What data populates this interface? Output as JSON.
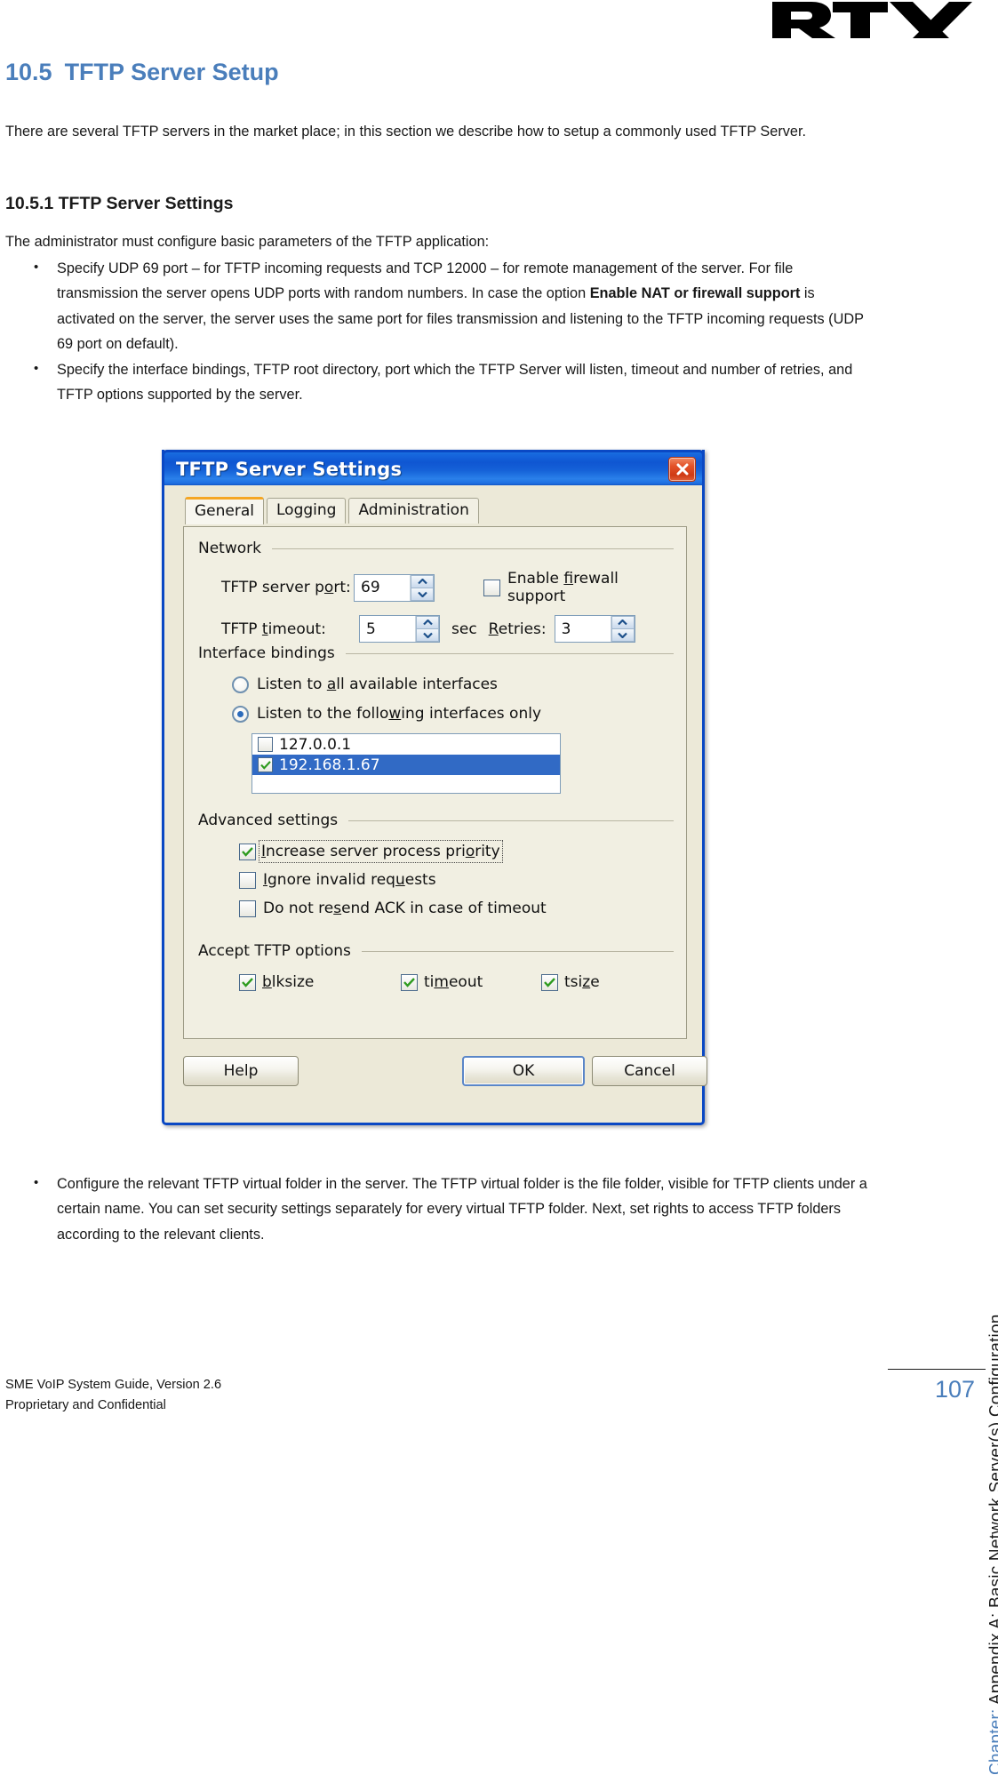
{
  "document": {
    "logo_alt": "RTX",
    "heading_number": "10.5",
    "heading_title": "TFTP Server Setup",
    "intro_paragraph": "There are several TFTP servers in the market place; in this section we describe how to setup a commonly used TFTP Server.",
    "subheading": "10.5.1 TFTP Server Settings",
    "admin_paragraph": "The administrator must configure basic parameters of the TFTP application:",
    "bullets_top": [
      {
        "pre": "Specify UDP 69 port – for TFTP incoming requests and TCP 12000 – for remote management of the server. For file transmission the server opens UDP ports with random numbers. In case the option ",
        "bold": "Enable NAT or firewall support",
        "post": " is activated on the server, the server uses the same port for files transmission and listening to the TFTP incoming requests (UDP 69 port on default)."
      },
      {
        "pre": "Specify the interface bindings, TFTP root directory, port which the TFTP Server will listen, timeout and number of retries, and TFTP options supported by the server.",
        "bold": "",
        "post": ""
      }
    ],
    "bullets_bottom": [
      {
        "pre": "Configure the relevant TFTP virtual folder in the server. The TFTP virtual folder is the file folder, visible for TFTP clients under a certain name. You can set security settings separately for every virtual TFTP folder. Next, set rights to access TFTP folders according to the relevant clients.",
        "bold": "",
        "post": ""
      }
    ],
    "sidebar_chapter": "Chapter: Appendix A: Basic Network Server(s) Configuration",
    "sidebar_chapter_prefix": "Chapter:",
    "sidebar_chapter_rest": " Appendix A: Basic Network Server(s) Configuration",
    "footer_line1": "SME VoIP System Guide, Version 2.6",
    "footer_line2": "Proprietary and Confidential",
    "page_number": "107",
    "colors": {
      "heading_blue": "#4a7ebb",
      "page_number_blue": "#4a7ebb",
      "title_bar_blue": "#1060d8",
      "selection_blue": "#316ac5",
      "check_green": "#2e9b1f",
      "close_red": "#d84315",
      "dialog_face": "#ece9d8",
      "tab_orange": "#f5a623"
    }
  },
  "dialog": {
    "title": "TFTP Server Settings",
    "close_icon": "close-icon",
    "tabs": [
      {
        "label": "General",
        "active": true
      },
      {
        "label": "Logging",
        "active": false
      },
      {
        "label": "Administration",
        "active": false
      }
    ],
    "network": {
      "group_label": "Network",
      "server_port_label": "TFTP server port:",
      "server_port_value": "69",
      "enable_firewall_label": "Enable firewall support",
      "enable_firewall_checked": false,
      "timeout_label": "TFTP timeout:",
      "timeout_value": "5",
      "sec_label": "sec",
      "retries_label": "Retries:",
      "retries_value": "3"
    },
    "interface_bindings": {
      "group_label": "Interface bindings",
      "radio_all_label": "Listen to all available interfaces",
      "radio_all_selected": false,
      "radio_following_label": "Listen to the following interfaces only",
      "radio_following_selected": true,
      "interfaces": [
        {
          "address": "127.0.0.1",
          "checked": false,
          "selected": false
        },
        {
          "address": "192.168.1.67",
          "checked": true,
          "selected": true
        }
      ]
    },
    "advanced": {
      "group_label": "Advanced settings",
      "options": [
        {
          "label": "Increase server process priority",
          "checked": true,
          "focused": true
        },
        {
          "label": "Ignore invalid requests",
          "checked": false,
          "focused": false
        },
        {
          "label": "Do not resend ACK in case of timeout",
          "checked": false,
          "focused": false
        }
      ]
    },
    "tftp_options": {
      "group_label": "Accept TFTP options",
      "options": [
        {
          "label": "blksize",
          "checked": true
        },
        {
          "label": "timeout",
          "checked": true
        },
        {
          "label": "tsize",
          "checked": true
        }
      ]
    },
    "buttons": {
      "help": "Help",
      "ok": "OK",
      "cancel": "Cancel"
    }
  }
}
